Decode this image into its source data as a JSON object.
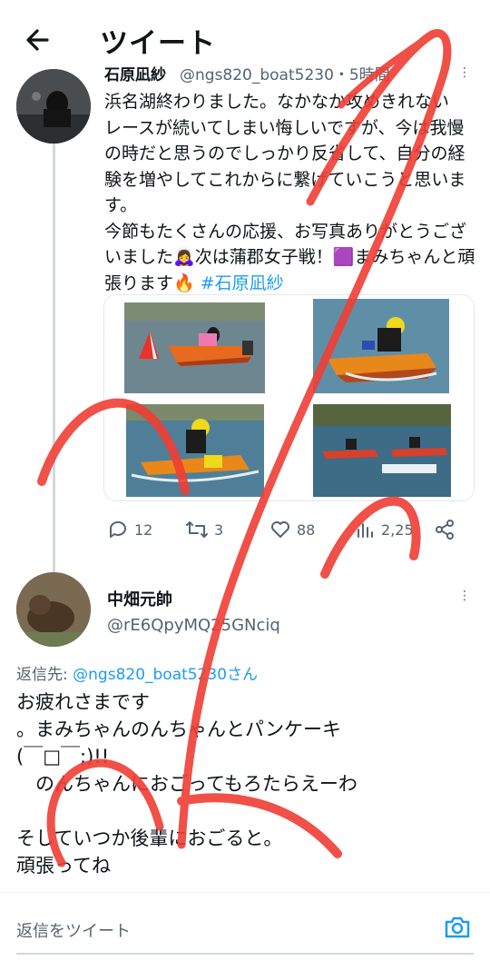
{
  "header": {
    "title": "ツイート",
    "back_icon": "arrow-left-icon"
  },
  "tweet1": {
    "author_name": "石原凪紗",
    "author_handle": "@ngs820_boat5230",
    "time": "・5時間",
    "text_line1": "浜名湖終わりました。なかなか攻めきれない",
    "text_line2": "レースが続いてしまい悔しいですが、今は我慢",
    "text_line3": "の時だと思うのでしっかり反省して、自分の経",
    "text_line4": "験を増やしてこれからに繋げていこうと思いま",
    "text_line5": "す。",
    "text_line6": "今節もたくさんの応援、お写真ありがとうござ",
    "text_line7a": "いました",
    "text_line7_emoji": "🙇‍♀️",
    "text_line7b": "次は蒲郡女子戦！",
    "text_line7_emoji2": "🟪",
    "text_line7c": "まみちゃんと頑",
    "text_line8a": "張ります",
    "text_line8_emoji": "🔥",
    "hashtag": "#石原凪紗",
    "stats": {
      "replies": "12",
      "retweets": "3",
      "likes": "88",
      "views": "2,25"
    }
  },
  "tweet2": {
    "author_name": "中畑元帥",
    "author_handle": "@rE6QpyMQ25GNciq",
    "replying_prefix": "返信先: ",
    "replying_to": "@ngs820_boat5230さん",
    "text": "お疲れさまです\n。まみちゃんのんちゃんとパンケーキ\n(￣□￣;)!!\n　のんちゃんにおごってもろたらえーわ\n\nそしていつか後輩におごると。\n頑張ってね"
  },
  "reply_bar": {
    "placeholder": "返信をツイート",
    "camera_icon": "camera-icon"
  },
  "colors": {
    "accent": "#1d9bf0",
    "scribble": "#ef3e34",
    "muted": "#536471"
  }
}
